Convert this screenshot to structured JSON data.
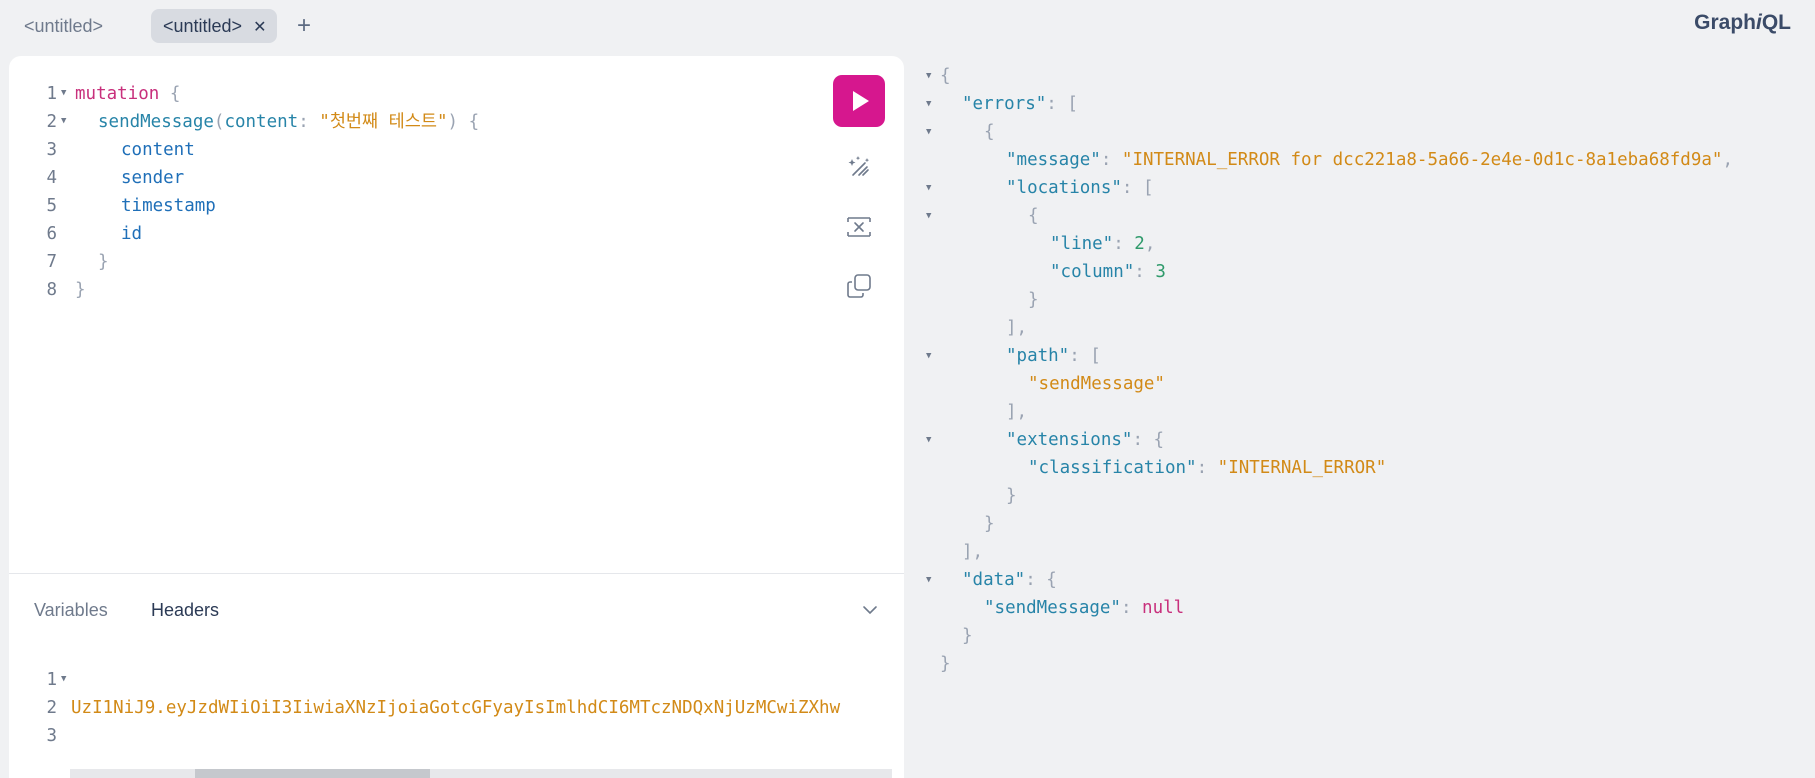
{
  "tabs": [
    {
      "label": "<untitled>",
      "active": false
    },
    {
      "label": "<untitled>",
      "active": true
    }
  ],
  "close_glyph": "✕",
  "add_tab_glyph": "+",
  "logo": {
    "prefix": "Graph",
    "italic": "i",
    "suffix": "QL"
  },
  "editor": {
    "line_numbers": [
      "1",
      "2",
      "3",
      "4",
      "5",
      "6",
      "7",
      "8"
    ],
    "tokens": {
      "l1_kw": "mutation",
      "l1_brace": " {",
      "l2_fn": "sendMessage",
      "l2_open": "(",
      "l2_arg": "content",
      "l2_colon": ": ",
      "l2_str": "\"첫번째 테스트\"",
      "l2_close": ") {",
      "l3": "content",
      "l4": "sender",
      "l5": "timestamp",
      "l6": "id",
      "l7": "}",
      "l8": "}"
    }
  },
  "toolbar": {
    "run_icon": "play-icon",
    "prettify_icon": "magic-wand-icon",
    "merge_icon": "merge-fragments-icon",
    "copy_icon": "copy-icon"
  },
  "bottom_tabs": {
    "variables": "Variables",
    "headers": "Headers"
  },
  "headers_editor": {
    "line_numbers": [
      "1",
      "2",
      "3"
    ],
    "line2": "UzI1NiJ9.eyJzdWIiOiI3IiwiaXNzIjoiaGotcGFyayIsImlhdCI6MTczNDQxNjUzMCwiZXhw"
  },
  "colors": {
    "accent": "#d6178e",
    "keyword": "#c8307c",
    "string": "#d28a17",
    "property": "#2784a8",
    "number": "#2f9a6b"
  },
  "result": {
    "open": "{",
    "errors_key": "\"errors\"",
    "message_key": "\"message\"",
    "message_val": "\"INTERNAL_ERROR for dcc221a8-5a66-2e4e-0d1c-8a1eba68fd9a\"",
    "locations_key": "\"locations\"",
    "line_key": "\"line\"",
    "line_val": "2",
    "column_key": "\"column\"",
    "column_val": "3",
    "path_key": "\"path\"",
    "path_val": "\"sendMessage\"",
    "extensions_key": "\"extensions\"",
    "classification_key": "\"classification\"",
    "classification_val": "\"INTERNAL_ERROR\"",
    "data_key": "\"data\"",
    "send_key": "\"sendMessage\"",
    "send_val": "null"
  }
}
